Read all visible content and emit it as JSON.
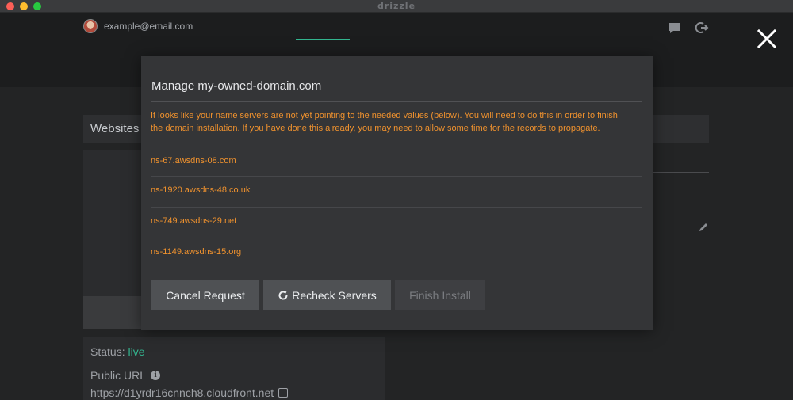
{
  "window": {
    "app_name": "drizzle"
  },
  "header": {
    "user_email": "example@email.com",
    "icons": [
      "chat-icon",
      "logout-icon"
    ]
  },
  "background": {
    "websites_label": "Websites",
    "status_label": "Status:",
    "status_value": "live",
    "public_url_label": "Public URL",
    "public_url_value": "https://d1yrdr16cnnch8.cloudfront.net"
  },
  "modal": {
    "title": "Manage my-owned-domain.com",
    "warning": "It looks like your name servers are not yet pointing to the needed values (below). You will need to do this in order to finish the domain installation. If you have done this already, you may need to allow some time for the records to propagate.",
    "name_servers": [
      "ns-67.awsdns-08.com",
      "ns-1920.awsdns-48.co.uk",
      "ns-749.awsdns-29.net",
      "ns-1149.awsdns-15.org"
    ],
    "buttons": {
      "cancel": "Cancel Request",
      "recheck": "Recheck Servers",
      "finish": "Finish Install"
    }
  },
  "colors": {
    "accent": "#33b58f",
    "warning": "#f0922e",
    "modal_bg": "#343537",
    "page_bg": "#232425"
  }
}
